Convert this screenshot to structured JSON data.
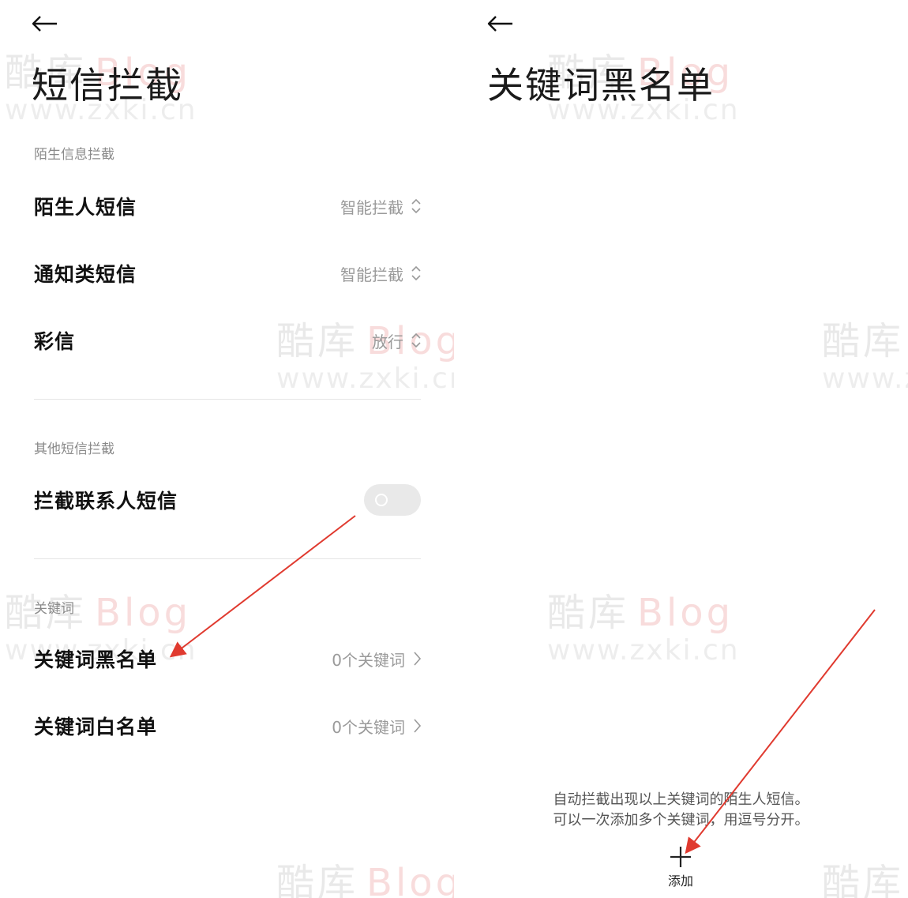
{
  "left": {
    "title": "短信拦截",
    "sections": {
      "stranger": "陌生信息拦截",
      "other": "其他短信拦截",
      "keywords": "关键词"
    },
    "rows": {
      "stranger_sms": {
        "label": "陌生人短信",
        "value": "智能拦截"
      },
      "notification_sms": {
        "label": "通知类短信",
        "value": "智能拦截"
      },
      "mms": {
        "label": "彩信",
        "value": "放行"
      },
      "block_contacts": {
        "label": "拦截联系人短信",
        "enabled": false
      },
      "keyword_blacklist": {
        "label": "关键词黑名单",
        "value": "0个关键词"
      },
      "keyword_whitelist": {
        "label": "关键词白名单",
        "value": "0个关键词"
      }
    }
  },
  "right": {
    "title": "关键词黑名单",
    "hint_line1": "自动拦截出现以上关键词的陌生人短信。",
    "hint_line2": "可以一次添加多个关键词，用逗号分开。",
    "add_label": "添加"
  },
  "watermark": {
    "brand_cn": "酷库",
    "brand_en": "Blog",
    "url": "www.zxki.cn"
  },
  "colors": {
    "annotation_arrow": "#e03a2f",
    "watermark_brand": "#f3c1c1"
  }
}
